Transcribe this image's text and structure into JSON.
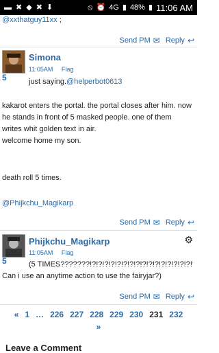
{
  "status_bar": {
    "left_icons": [
      "sms-icon",
      "x-icon",
      "generic-icon",
      "x-icon",
      "download-icon"
    ],
    "battery": "48%",
    "time": "11:06 AM",
    "network": "4G"
  },
  "post0": {
    "mention": "@xxthatguy11xx",
    "suffix": ";"
  },
  "actions": {
    "send_pm": "Send PM",
    "reply": "Reply"
  },
  "post1": {
    "number": "5",
    "author": "Simona",
    "time": "11:05AM",
    "flag": "Flag",
    "lead": "just saying.",
    "lead_mention": "@helperbot0613",
    "para1": "kakarot enters the portal. the portal closes after him. now he stands in front of 5 masked people. one of them writes whit golden text in air.",
    "para2": "welcome home my son.",
    "para3": "death roll 5 times.",
    "mention": "@Phijkchu_Magikarp"
  },
  "post2": {
    "number": "5",
    "author": "Phijkchu_Magikarp",
    "time": "11:05AM",
    "flag": "Flag",
    "line1": "(5 TIMES???????!?!?!?!?!?!?!?!?!?!?!?!?!?!?!?!?!?",
    "line2": "Can i use an anytime action to use the fairyjar?)"
  },
  "pagination": {
    "prev": "«",
    "pages": [
      "1",
      "…",
      "226",
      "227",
      "228",
      "229",
      "230",
      "231",
      "232"
    ],
    "current": "231",
    "next": "»"
  },
  "leave_comment": "Leave a Comment",
  "colors": {
    "link": "#2c6aa8",
    "text": "#222222",
    "status_bar": "#000000"
  }
}
